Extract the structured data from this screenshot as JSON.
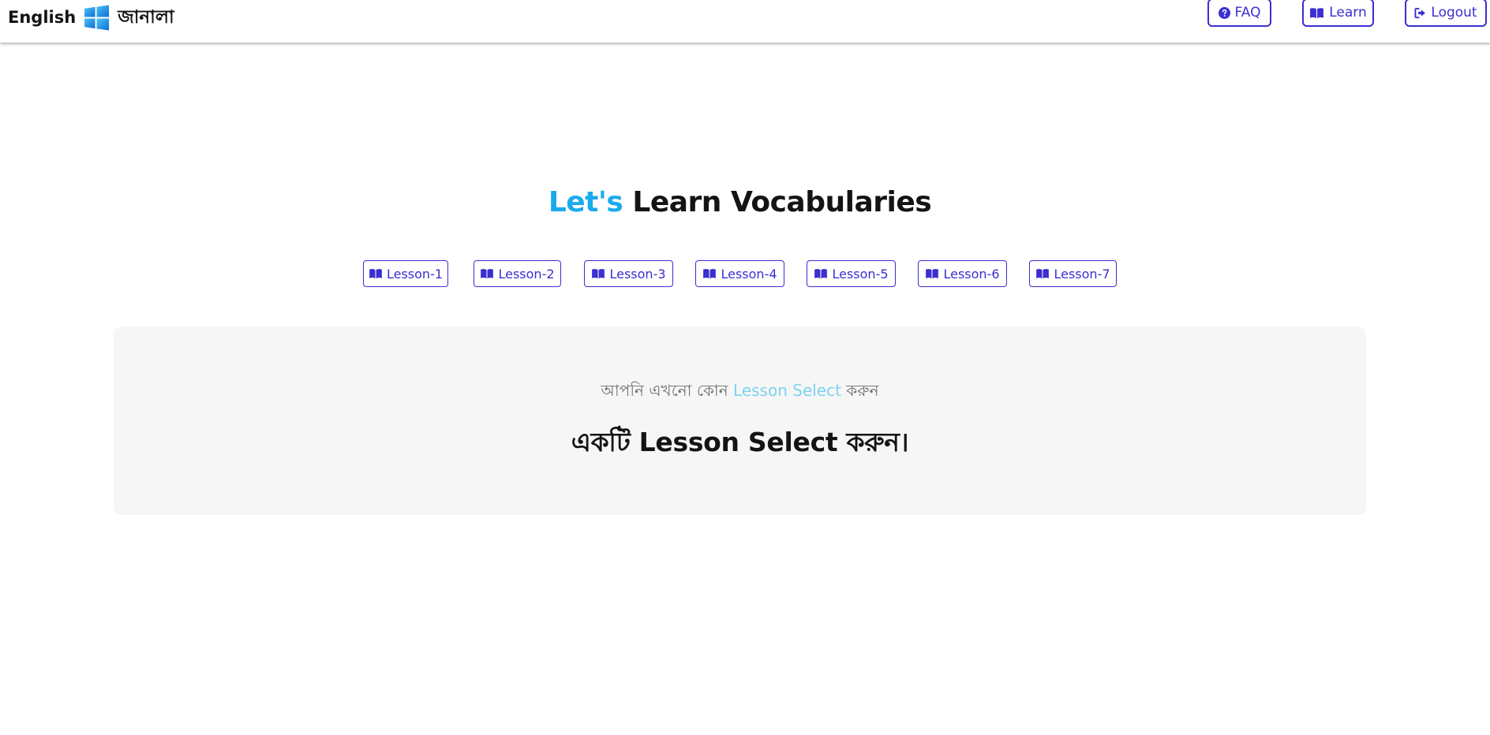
{
  "navbar": {
    "brand_english": "English",
    "brand_bangla": "জানালা",
    "brand_icon": "windows-logo-icon",
    "faq_label": "FAQ",
    "faq_icon": "question-circle-icon",
    "learn_label": "Learn",
    "learn_icon": "open-book-icon",
    "logout_label": "Logout",
    "logout_icon": "sign-out-icon"
  },
  "hero": {
    "title_accent": "Let's",
    "title_rest": " Learn Vocabularies"
  },
  "lessons": [
    {
      "label": "Lesson-1",
      "icon": "open-book-icon"
    },
    {
      "label": "Lesson-2",
      "icon": "open-book-icon"
    },
    {
      "label": "Lesson-3",
      "icon": "open-book-icon"
    },
    {
      "label": "Lesson-4",
      "icon": "open-book-icon"
    },
    {
      "label": "Lesson-5",
      "icon": "open-book-icon"
    },
    {
      "label": "Lesson-6",
      "icon": "open-book-icon"
    },
    {
      "label": "Lesson-7",
      "icon": "open-book-icon"
    }
  ],
  "placeholder": {
    "subtitle_before": "আপনি এখনো কোন ",
    "subtitle_accent": "Lesson Select",
    "subtitle_after": " করুন",
    "main_text": "একটি Lesson Select করুন।"
  },
  "colors": {
    "primary": "#3c2ed0",
    "accent": "#1aaaee",
    "accent_light": "#7cd3f0",
    "card_background": "#f6f6f6",
    "text_dark": "#141414",
    "text_muted": "#6f6f6f"
  }
}
